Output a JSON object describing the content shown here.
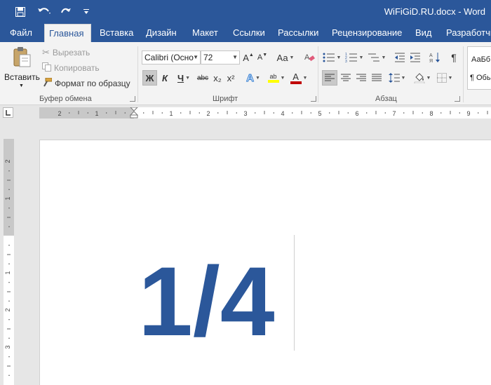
{
  "title_bar": {
    "document_title": "WiFiGiD.RU.docx - Word",
    "quick_access": [
      "save-icon",
      "undo-icon",
      "redo-icon",
      "customize-icon"
    ]
  },
  "tabs": [
    {
      "label": "Файл",
      "active": false
    },
    {
      "label": "Главная",
      "active": true
    },
    {
      "label": "Вставка",
      "active": false
    },
    {
      "label": "Дизайн",
      "active": false
    },
    {
      "label": "Макет",
      "active": false
    },
    {
      "label": "Ссылки",
      "active": false
    },
    {
      "label": "Рассылки",
      "active": false
    },
    {
      "label": "Рецензирование",
      "active": false
    },
    {
      "label": "Вид",
      "active": false
    },
    {
      "label": "Разработчик",
      "active": false
    }
  ],
  "ribbon": {
    "clipboard": {
      "paste_label": "Вставить",
      "cut_label": "Вырезать",
      "copy_label": "Копировать",
      "format_painter_label": "Формат по образцу",
      "group_label": "Буфер обмена"
    },
    "font": {
      "font_name": "Calibri (Осно",
      "font_size": "72",
      "change_case_label": "Аа",
      "bold_label": "Ж",
      "italic_label": "К",
      "underline_label": "Ч",
      "strike_label": "abc",
      "subscript_label": "x₂",
      "superscript_label": "x²",
      "highlight_label": "ab",
      "font_color_label": "А",
      "highlight_color": "#ffff00",
      "font_color": "#c00000",
      "group_label": "Шрифт"
    },
    "paragraph": {
      "group_label": "Абзац"
    },
    "styles": {
      "preview_label": "АаБбВ",
      "style_name": "¶ Обы"
    }
  },
  "document": {
    "content": "1/4",
    "text_color": "#2b579a"
  },
  "colors": {
    "accent": "#2b579a",
    "ribbon_bg": "#f3f3f3",
    "workspace_bg": "#e6e6e6"
  }
}
